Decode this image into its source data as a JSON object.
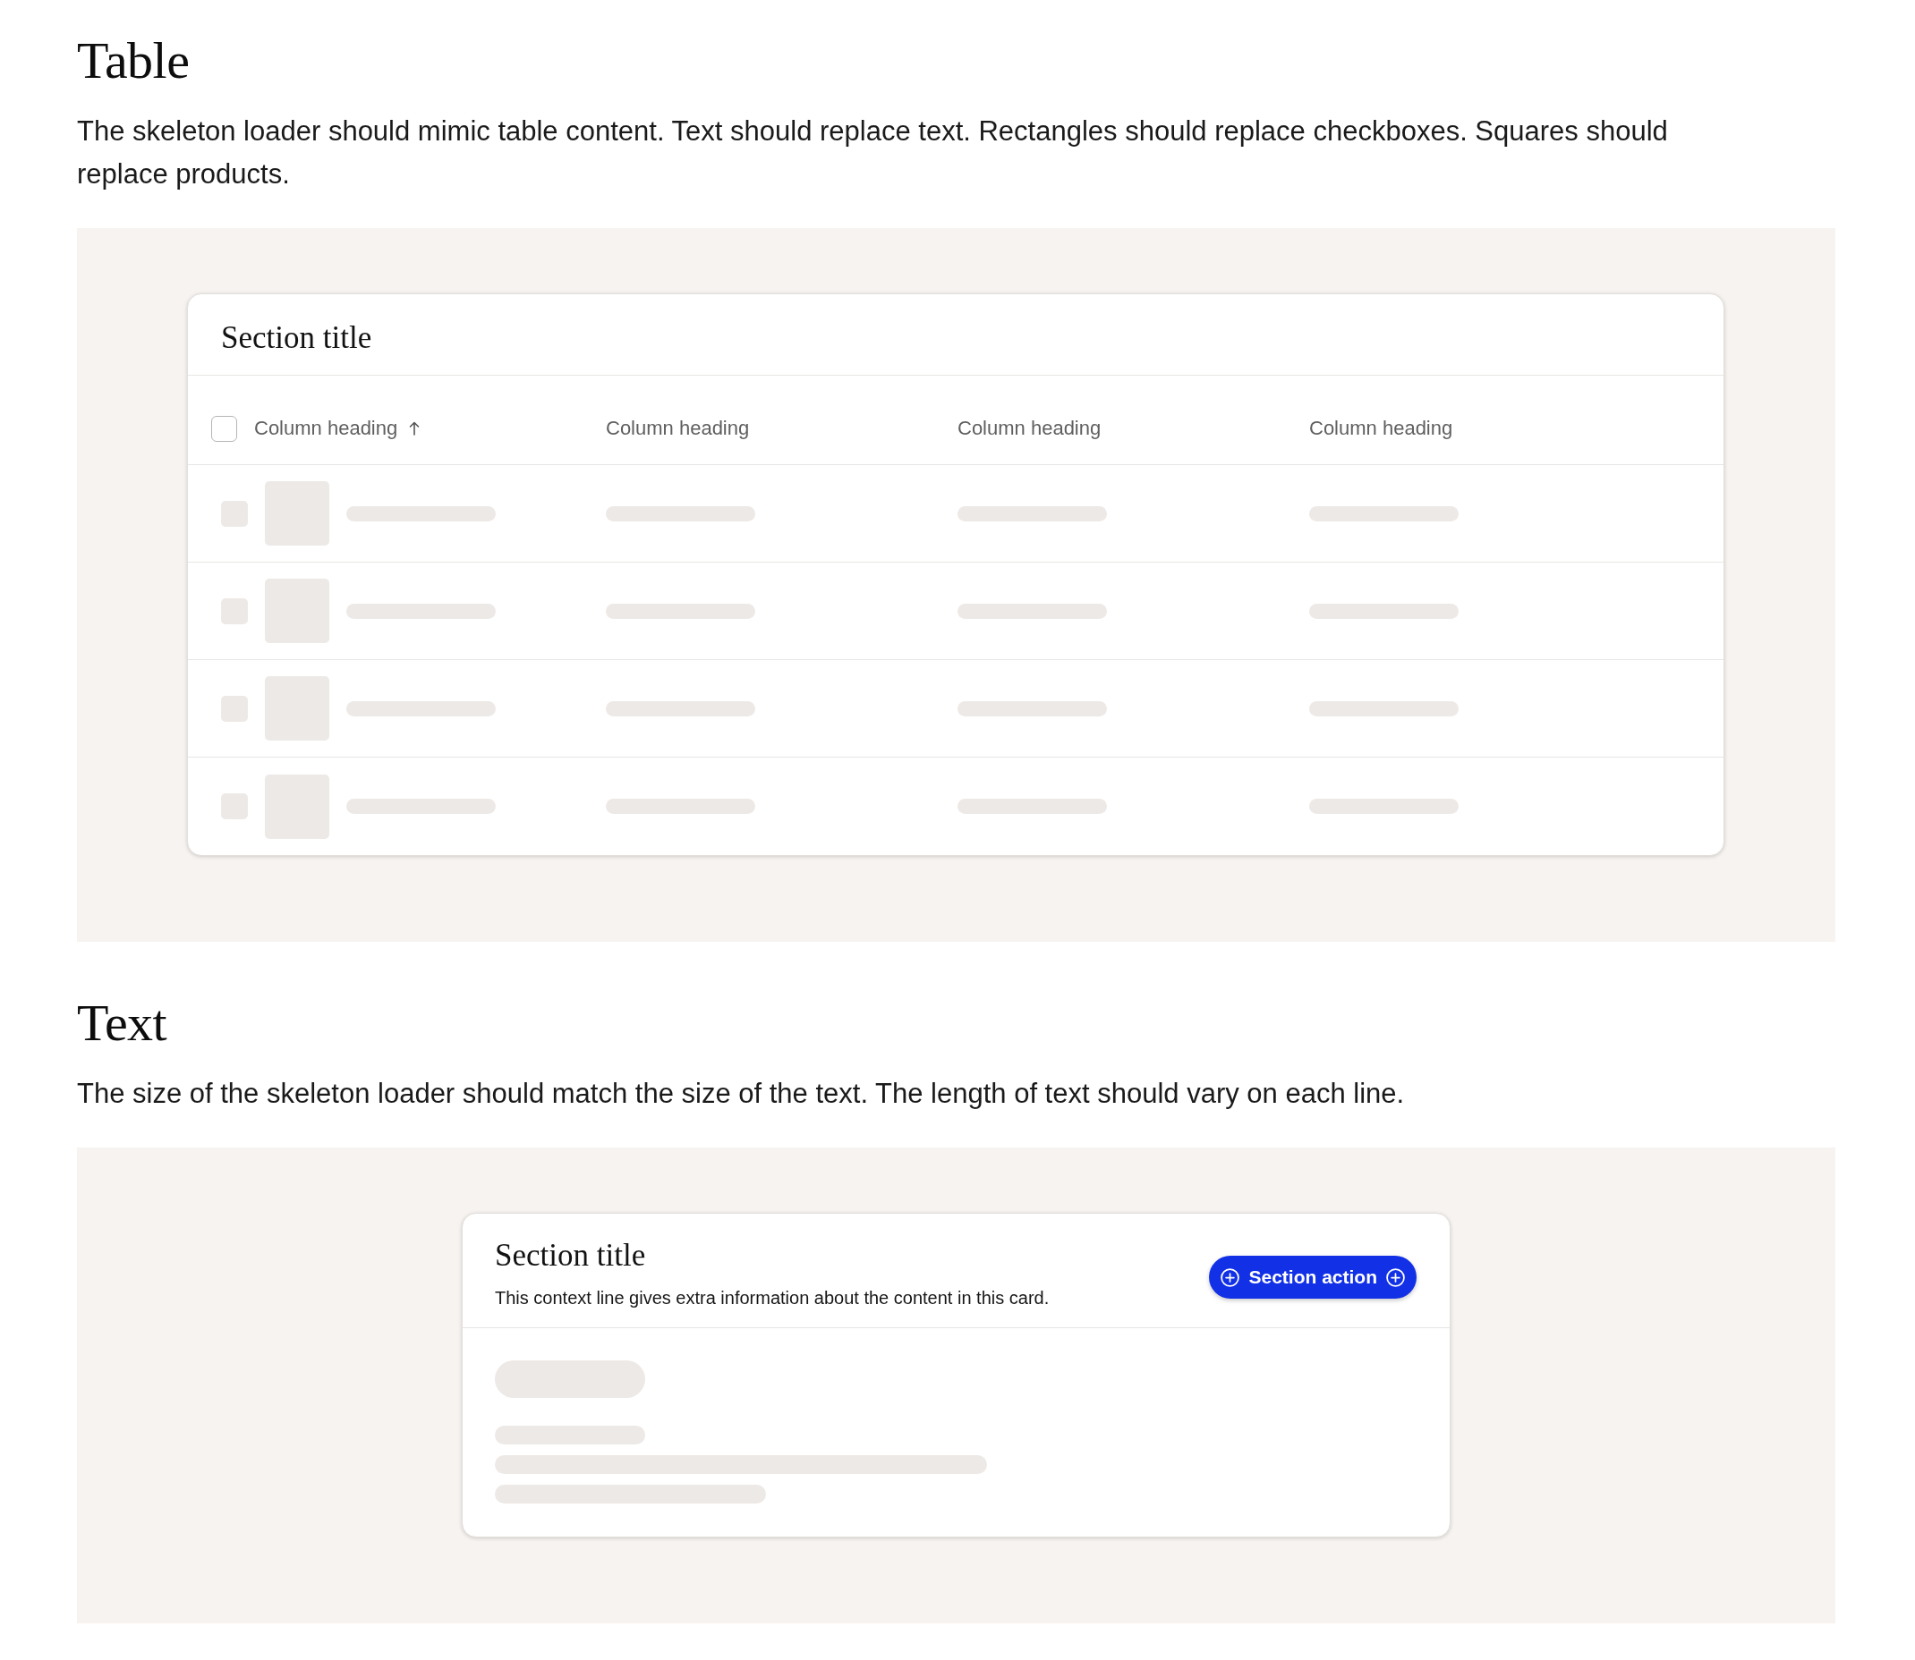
{
  "sections": [
    {
      "kind": "table",
      "heading": "Table",
      "description": "The skeleton loader should mimic table content. Text should replace text. Rectangles should replace checkboxes. Squares should replace products.",
      "card": {
        "title": "Section title",
        "select_all": {
          "checked": false
        },
        "columns": [
          {
            "label": "Column heading",
            "sorted": true
          },
          {
            "label": "Column heading",
            "sorted": false
          },
          {
            "label": "Column heading",
            "sorted": false
          },
          {
            "label": "Column heading",
            "sorted": false
          }
        ],
        "rows": [
          {
            "loading": true
          },
          {
            "loading": true
          },
          {
            "loading": true
          },
          {
            "loading": true
          }
        ]
      }
    },
    {
      "kind": "text",
      "heading": "Text",
      "description": "The size of the skeleton loader should match the size of the text. The length of text should vary on each line.",
      "card": {
        "title": "Section title",
        "context": "This context line gives extra information about the content in this card.",
        "action": {
          "label": "Section action"
        },
        "skeleton": [
          {
            "kind": "title"
          },
          {
            "kind": "short"
          },
          {
            "kind": "long"
          },
          {
            "kind": "medium"
          }
        ]
      }
    }
  ]
}
